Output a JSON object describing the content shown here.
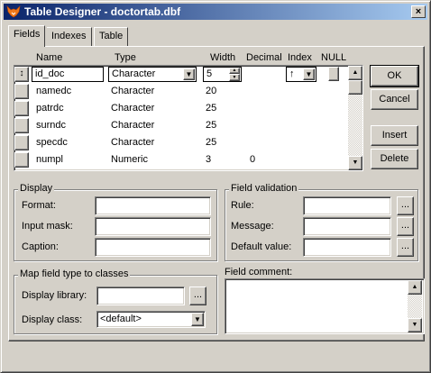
{
  "window": {
    "title": "Table Designer - doctortab.dbf",
    "close_glyph": "×"
  },
  "tabs": [
    {
      "label": "Fields"
    },
    {
      "label": "Indexes"
    },
    {
      "label": "Table"
    }
  ],
  "grid": {
    "headers": {
      "name": "Name",
      "type": "Type",
      "width": "Width",
      "decimal": "Decimal",
      "index": "Index",
      "null": "NULL"
    },
    "row_marker": "↕",
    "editing": {
      "name": "id_doc",
      "type": "Character",
      "width": "5",
      "index_arrow": "↑"
    },
    "rows": [
      {
        "name": "namedc",
        "type": "Character",
        "width": "20",
        "decimal": ""
      },
      {
        "name": "patrdc",
        "type": "Character",
        "width": "25",
        "decimal": ""
      },
      {
        "name": "surndc",
        "type": "Character",
        "width": "25",
        "decimal": ""
      },
      {
        "name": "specdc",
        "type": "Character",
        "width": "25",
        "decimal": ""
      },
      {
        "name": "numpl",
        "type": "Numeric",
        "width": "3",
        "decimal": "0"
      }
    ]
  },
  "buttons": {
    "ok": "OK",
    "cancel": "Cancel",
    "insert": "Insert",
    "delete": "Delete"
  },
  "display": {
    "title": "Display",
    "format_label": "Format:",
    "format_value": "",
    "input_mask_label": "Input mask:",
    "input_mask_value": "",
    "caption_label": "Caption:",
    "caption_value": ""
  },
  "validation": {
    "title": "Field validation",
    "rule_label": "Rule:",
    "rule_value": "",
    "message_label": "Message:",
    "message_value": "",
    "default_label": "Default value:",
    "default_value": ""
  },
  "mapping": {
    "title": "Map field type to classes",
    "library_label": "Display library:",
    "library_value": "",
    "class_label": "Display class:",
    "class_value": "<default>"
  },
  "comment": {
    "label": "Field comment:",
    "value": ""
  },
  "ellipsis": "...",
  "icons": {
    "app": "fox-icon",
    "dropdown": "▼",
    "up": "▲",
    "down": "▼"
  }
}
